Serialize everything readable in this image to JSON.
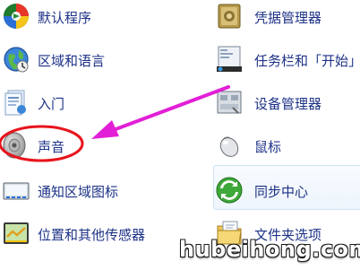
{
  "items_left": [
    {
      "label": "默认程序",
      "icon": "default-programs-icon"
    },
    {
      "label": "区域和语言",
      "icon": "region-language-icon"
    },
    {
      "label": "入门",
      "icon": "getting-started-icon"
    },
    {
      "label": "声音",
      "icon": "sound-icon"
    },
    {
      "label": "通知区域图标",
      "icon": "notification-icons-icon"
    },
    {
      "label": "位置和其他传感器",
      "icon": "location-sensors-icon"
    }
  ],
  "items_right": [
    {
      "label": "凭据管理器",
      "icon": "credential-manager-icon"
    },
    {
      "label": "任务栏和「开始」",
      "icon": "taskbar-start-icon"
    },
    {
      "label": "设备管理器",
      "icon": "device-manager-icon"
    },
    {
      "label": "鼠标",
      "icon": "mouse-icon"
    },
    {
      "label": "同步中心",
      "icon": "sync-center-icon"
    },
    {
      "label": "文件夹选项",
      "icon": "folder-options-icon"
    }
  ],
  "annotation": {
    "arrow_color": "#e21fd6",
    "ellipse_color": "#e8141c"
  },
  "watermark": "hubeihong.com"
}
